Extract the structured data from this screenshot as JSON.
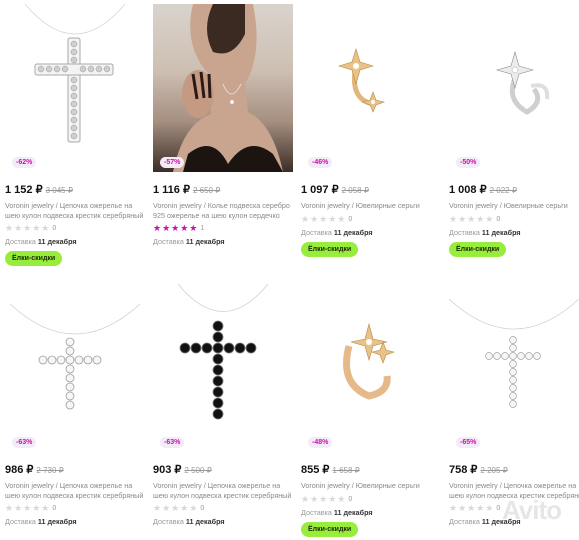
{
  "products": [
    {
      "discount": "-62%",
      "price": "1 152 ₽",
      "old_price": "3 045 ₽",
      "brand": "Voronin jewelry",
      "title": "Цепочка ожерелье на шею кулон подвеска крестик серебряный",
      "rating_count": "0",
      "delivery_label": "Доставка",
      "delivery_date": "11 декабря",
      "tag": "Ёлки-скидки",
      "image_icon": "cross-pendant-icon"
    },
    {
      "discount": "-57%",
      "price": "1 116 ₽",
      "old_price": "2 650 ₽",
      "brand": "Voronin jewelry",
      "title": "Колье подвеска серебро 925 ожерелье на шею кулон сердечко",
      "rating_count": "1",
      "delivery_label": "Доставка",
      "delivery_date": "11 декабря",
      "tag": "",
      "image_icon": "model-photo"
    },
    {
      "discount": "-46%",
      "price": "1 097 ₽",
      "old_price": "2 058 ₽",
      "brand": "Voronin jewelry",
      "title": "Ювелирные серьги",
      "rating_count": "0",
      "delivery_label": "Доставка",
      "delivery_date": "11 декабря",
      "tag": "Ёлки-скидки",
      "image_icon": "star-earcuff-gold-icon"
    },
    {
      "discount": "-50%",
      "price": "1 008 ₽",
      "old_price": "2 022 ₽",
      "brand": "Voronin jewelry",
      "title": "Ювелирные серьги",
      "rating_count": "0",
      "delivery_label": "Доставка",
      "delivery_date": "11 декабря",
      "tag": "Ёлки-скидки",
      "image_icon": "star-earcuff-silver-icon"
    },
    {
      "discount": "-63%",
      "price": "986 ₽",
      "old_price": "2 730 ₽",
      "brand": "Voronin jewelry",
      "title": "Цепочка ожерелье на шею кулон подвеска крестик серебряный",
      "rating_count": "0",
      "delivery_label": "Доставка",
      "delivery_date": "11 декабря",
      "tag": "",
      "image_icon": "cross-pendant-icon"
    },
    {
      "discount": "-63%",
      "price": "903 ₽",
      "old_price": "2 500 ₽",
      "brand": "Voronin jewelry",
      "title": "Цепочка ожерелье на шею кулон подвеска крестик серебряный",
      "rating_count": "0",
      "delivery_label": "Доставка",
      "delivery_date": "11 декабря",
      "tag": "",
      "image_icon": "black-cross-pendant-icon"
    },
    {
      "discount": "-48%",
      "price": "855 ₽",
      "old_price": "1 658 ₽",
      "brand": "Voronin jewelry",
      "title": "Ювелирные серьги",
      "rating_count": "0",
      "delivery_label": "Доставка",
      "delivery_date": "11 декабря",
      "tag": "Ёлки-скидки",
      "image_icon": "star-earcuff-gold-icon"
    },
    {
      "discount": "-65%",
      "price": "758 ₽",
      "old_price": "2 205 ₽",
      "brand": "Voronin jewelry",
      "title": "Цепочка ожерелье на шею кулон подвеска крестик серебряный",
      "rating_count": "0",
      "delivery_label": "Доставка",
      "delivery_date": "11 декабря",
      "tag": "",
      "image_icon": "cross-pendant-icon"
    }
  ],
  "separator": " / ",
  "watermark": "Avito",
  "colors": {
    "accent": "#cb11ab",
    "tag_bg": "#98ec3b",
    "discount_bg": "#f4ebf8"
  }
}
